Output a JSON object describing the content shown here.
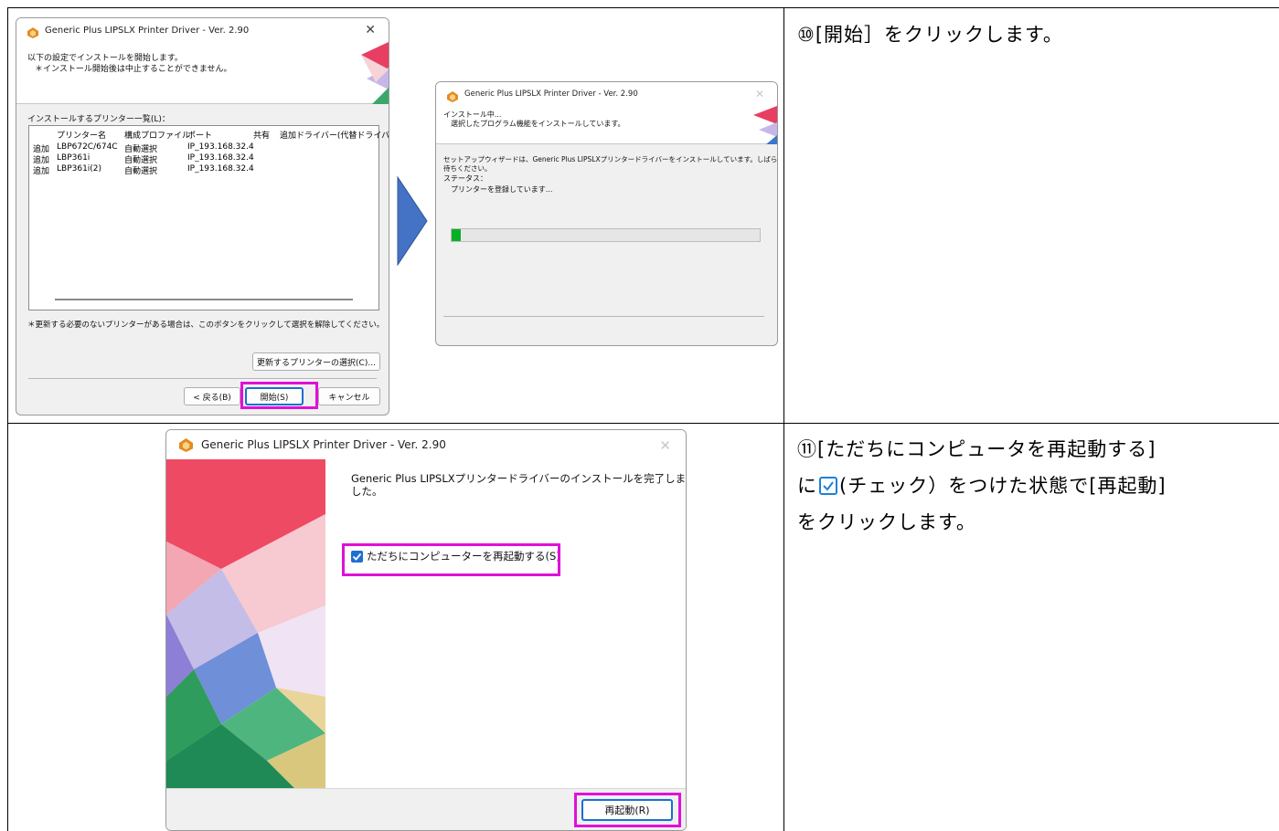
{
  "step10": {
    "number": "⑩",
    "text": "[開始］をクリックします。"
  },
  "step11": {
    "number": "⑪",
    "line1": "[ただちにコンピュータを再起動する]",
    "line2_pre": "に",
    "line2_post": "(チェック）をつけた状態で[再起動]",
    "line3": "をクリックします。"
  },
  "win1": {
    "title": "Generic Plus LIPSLX Printer Driver - Ver. 2.90",
    "header_line1": "以下の設定でインストールを開始します。",
    "header_line2": "＊インストール開始後は中止することができません。",
    "list_label": "インストールするプリンター一覧(L)：",
    "columns": [
      "プリンター名",
      "構成プロファイル",
      "ポート",
      "共有",
      "追加ドライバー(代替ドライバ"
    ],
    "rows": [
      {
        "action": "追加",
        "name": "LBP672C/674C",
        "profile": "自動選択",
        "port": "IP_193.168.32.4"
      },
      {
        "action": "追加",
        "name": "LBP361i",
        "profile": "自動選択",
        "port": "IP_193.168.32.4"
      },
      {
        "action": "追加",
        "name": "LBP361i(2)",
        "profile": "自動選択",
        "port": "IP_193.168.32.4"
      }
    ],
    "note": "＊更新する必要のないプリンターがある場合は、このボタンをクリックして選択を解除してください。",
    "select_button": "更新するプリンターの選択(C)...",
    "back_button": "< 戻る(B)",
    "start_button": "開始(S)",
    "cancel_button": "キャンセル"
  },
  "win2": {
    "title": "Generic Plus LIPSLX Printer Driver - Ver. 2.90",
    "header_line1": "インストール中...",
    "header_line2": "選択したプログラム機能をインストールしています。",
    "body_line1": "セットアップウィザードは、Generic Plus LIPSLXプリンタードライバーをインストールしています。しばらくお",
    "body_line2": "待ちください。",
    "status_label": "ステータス：",
    "status_value": "プリンターを登録しています...",
    "progress": 0.03
  },
  "win3": {
    "title": "Generic Plus LIPSLX Printer Driver - Ver. 2.90",
    "message_line1": "Generic Plus LIPSLXプリンタードライバーのインストールを完了しま",
    "message_line2": "した。",
    "checkbox_label": "ただちにコンピューターを再起動する(S)",
    "checkbox_checked": true,
    "restart_button": "再起動(R)"
  },
  "colors": {
    "highlight": "#e010d8",
    "arrow": "#4472c4",
    "progress": "#06b025",
    "checkbox": "#1a82d8"
  }
}
